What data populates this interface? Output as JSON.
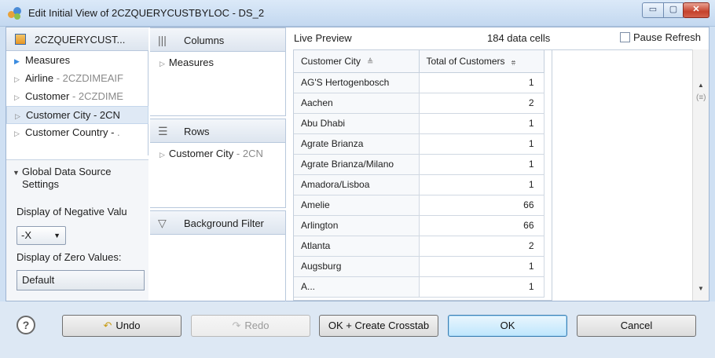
{
  "window": {
    "title": "Edit Initial View of 2CZQUERYCUSTBYLOC - DS_2",
    "controls": {
      "minimize": "▭",
      "maximize": "▢",
      "close": "✕"
    }
  },
  "data_source": {
    "name": "2CZQUERYCUST...",
    "tree": [
      {
        "label": "Measures",
        "sub": "",
        "selected": false
      },
      {
        "label": "Airline",
        "sub": " - 2CZDIMEAIF",
        "selected": false
      },
      {
        "label": "Customer",
        "sub": " - 2CZDIME",
        "selected": false
      },
      {
        "label": "Customer City - 2CN",
        "sub": "",
        "selected": true
      },
      {
        "label": "Customer Country - ",
        "sub": ".",
        "selected": false
      }
    ]
  },
  "global_settings": {
    "header_line1": "Global Data Source",
    "header_line2": "Settings",
    "neg_label": "Display of Negative Valu",
    "neg_value": "-X",
    "zero_label": "Display of Zero Values:",
    "zero_value": "Default"
  },
  "columns": {
    "title": "Columns",
    "items": [
      {
        "label": "Measures",
        "sub": ""
      }
    ]
  },
  "rows": {
    "title": "Rows",
    "items": [
      {
        "label": "Customer City",
        "sub": " - 2CN"
      }
    ]
  },
  "background_filter": {
    "title": "Background Filter"
  },
  "preview": {
    "title": "Live Preview",
    "cells": "184 data cells",
    "pause_label": "Pause Refresh",
    "col1": "Customer City",
    "col2": "Total of Customers",
    "rows": [
      [
        "AG'S Hertogenbosch",
        "1"
      ],
      [
        "Aachen",
        "2"
      ],
      [
        "Abu Dhabi",
        "1"
      ],
      [
        "Agrate Brianza",
        "1"
      ],
      [
        "Agrate Brianza/Milano",
        "1"
      ],
      [
        "Amadora/Lisboa",
        "1"
      ],
      [
        "Amelie",
        "66"
      ],
      [
        "Arlington",
        "66"
      ],
      [
        "Atlanta",
        "2"
      ],
      [
        "Augsburg",
        "1"
      ],
      [
        "A...",
        "1"
      ]
    ]
  },
  "buttons": {
    "help": "?",
    "undo": "Undo",
    "redo": "Redo",
    "ok_crosstab": "OK + Create Crosstab",
    "ok": "OK",
    "cancel": "Cancel"
  },
  "icon_names": [
    "app-icon",
    "data-source-icon",
    "columns-icon",
    "rows-icon",
    "filter-icon",
    "help-icon",
    "undo-icon",
    "redo-icon"
  ]
}
